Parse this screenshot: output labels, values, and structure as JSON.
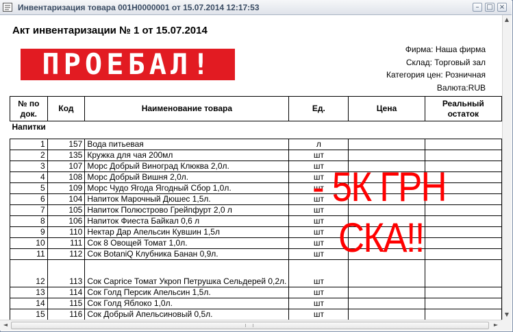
{
  "window": {
    "title": "Инвентаризация товара 001Н0000001 от 15.07.2014 12:17:53",
    "min_glyph": "–",
    "max_glyph": "□",
    "close_glyph": "×"
  },
  "document": {
    "title": "Акт инвентаризации № 1 от 15.07.2014",
    "stamp": "ПРОЕБАЛ!",
    "info": {
      "firm": "Фирма: Наша фирма",
      "warehouse": "Склад: Торговый зал",
      "price_category": "Категория цен: Розничная",
      "currency": "Валюта:RUB"
    },
    "columns": {
      "num": "№ по док.",
      "code": "Код",
      "name": "Наименование товара",
      "unit": "Ед.",
      "price": "Цена",
      "actual": "Реальный остаток"
    },
    "group": "Напитки",
    "rows": [
      {
        "num": "1",
        "code": "157",
        "name": "Вода питьевая",
        "unit": "л"
      },
      {
        "num": "2",
        "code": "135",
        "name": "Кружка для чая 200мл",
        "unit": "шт"
      },
      {
        "num": "3",
        "code": "107",
        "name": "Морс Добрый Виноград Клюква 2,0л.",
        "unit": "шт"
      },
      {
        "num": "4",
        "code": "108",
        "name": "Морс Добрый Вишня 2,0л.",
        "unit": "шт"
      },
      {
        "num": "5",
        "code": "109",
        "name": "Морс Чудо Ягода  Ягодный Сбор 1,0л.",
        "unit": "шт"
      },
      {
        "num": "6",
        "code": "104",
        "name": "Напиток Марочный Дюшес 1,5л.",
        "unit": "шт"
      },
      {
        "num": "7",
        "code": "105",
        "name": "Напиток Полюстрово Грейпфурт 2,0 л",
        "unit": "шт"
      },
      {
        "num": "8",
        "code": "106",
        "name": "Напиток Фиеста Байкал  0,6 л",
        "unit": "шт"
      },
      {
        "num": "9",
        "code": "110",
        "name": "Нектар Дар Апельсин Кувшин 1,5л",
        "unit": "шт"
      },
      {
        "num": "10",
        "code": "111",
        "name": "Сок 8 Овощей Томат 1,0л.",
        "unit": "шт"
      },
      {
        "num": "11",
        "code": "112",
        "name": "Сок BotaniQ Клубника Банан 0,9л.",
        "unit": "шт"
      },
      {
        "num": "12",
        "code": "113",
        "name": "Сок Caprice Томат Укроп Петрушка Сельдерей 0,2л.",
        "unit": "шт"
      },
      {
        "num": "13",
        "code": "114",
        "name": "Сок Голд Персик Апельсин 1,5л.",
        "unit": "шт"
      },
      {
        "num": "14",
        "code": "115",
        "name": "Сок Голд Яблоко 1,0л.",
        "unit": "шт"
      },
      {
        "num": "15",
        "code": "116",
        "name": "Сок Добрый Апельсиновый 0,5л.",
        "unit": "шт"
      }
    ]
  },
  "overlay": {
    "line1": "- 5К ГРН",
    "line2": "СКА!!"
  },
  "scroll": {
    "up": "▲",
    "down": "▼",
    "left": "◄",
    "right": "►"
  },
  "colors": {
    "stamp": "#e21b22",
    "overlay_text": "#ff0000"
  }
}
